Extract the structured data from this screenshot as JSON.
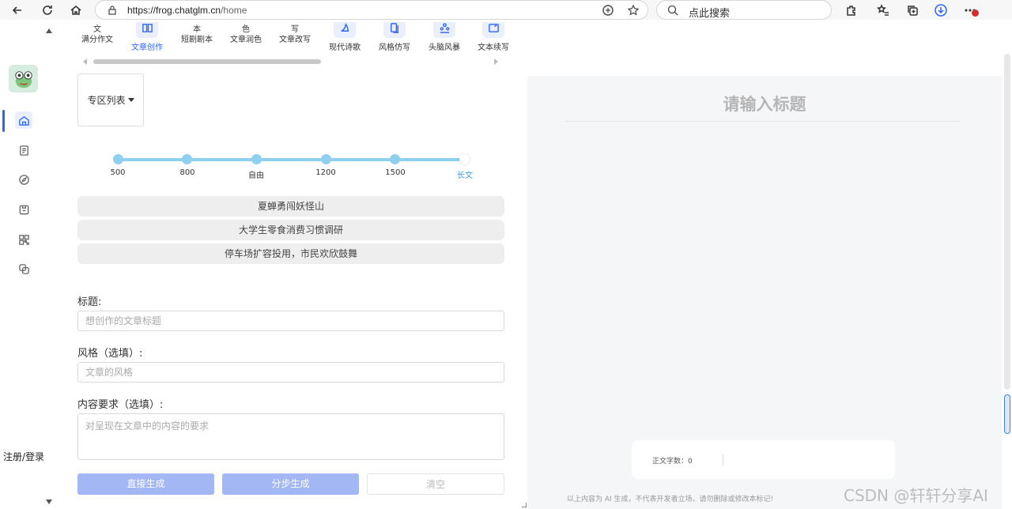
{
  "browser": {
    "url_host": "https://frog.chatglm.cn",
    "url_path": "/home",
    "search_placeholder": "点此搜索"
  },
  "sidebar": {
    "login_label": "注册/登录",
    "items": [
      "home-icon",
      "document-icon",
      "compass-icon",
      "folder-icon",
      "grid-icon",
      "copy-icon"
    ]
  },
  "tools": [
    {
      "top": "文",
      "label": "满分作文"
    },
    {
      "label": "文章创作",
      "selected": true
    },
    {
      "top": "本",
      "label": "短剧剧本"
    },
    {
      "top": "色",
      "label": "文章润色"
    },
    {
      "top": "写",
      "label": "文章改写"
    },
    {
      "label": "现代诗歌"
    },
    {
      "label": "风格仿写"
    },
    {
      "label": "头脑风暴"
    },
    {
      "label": "文本续写"
    }
  ],
  "zone": {
    "label": "专区列表"
  },
  "length_options": [
    "500",
    "800",
    "自由",
    "1200",
    "1500",
    "长文"
  ],
  "length_selected": "长文",
  "suggestions": [
    "夏蝉勇闯妖怪山",
    "大学生零食消费习惯调研",
    "停车场扩容投用，市民欢欣鼓舞"
  ],
  "form": {
    "title_label": "标题:",
    "title_placeholder": "想创作的文章标题",
    "style_label": "风格（选填）:",
    "style_placeholder": "文章的风格",
    "content_label": "内容要求（选填）:",
    "content_placeholder": "对呈现在文章中的内容的要求"
  },
  "buttons": {
    "direct": "直接生成",
    "step": "分步生成",
    "clear": "清空"
  },
  "preview": {
    "title_placeholder": "请输入标题",
    "word_count_label": "正文字数：0",
    "disclaimer": "以上内容为 AI 生成，不代表开发者立场，请勿删除或修改本标记!"
  },
  "watermark": "CSDN @轩轩分享AI",
  "colors": {
    "accent": "#2f64f5",
    "slider": "#8fd0ef",
    "primary_button": "#a4b7f5"
  }
}
